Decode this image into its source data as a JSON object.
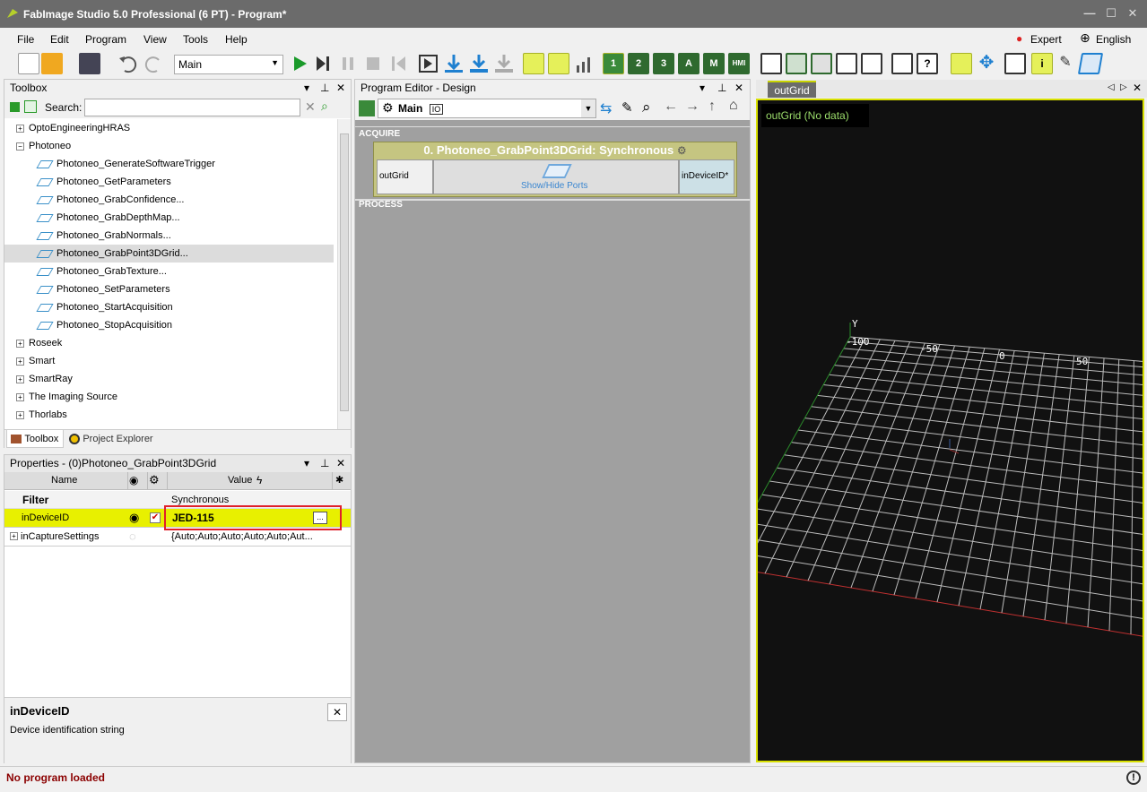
{
  "window": {
    "title": "FabImage Studio 5.0 Professional (6 PT) - Program*",
    "minimize": "—",
    "maximize": "☐",
    "close": "✕"
  },
  "menu": [
    "File",
    "Edit",
    "Program",
    "View",
    "Tools",
    "Help"
  ],
  "menu_right": {
    "expert": "Expert",
    "language": "English"
  },
  "toolbar": {
    "program_select": "Main",
    "toggle_buttons": [
      "1",
      "2",
      "3",
      "A",
      "M",
      "HMI"
    ]
  },
  "toolbox": {
    "title": "Toolbox",
    "search_label": "Search:",
    "search_value": "",
    "items": [
      {
        "label": "OptoEngineeringHRAS",
        "level": 0,
        "expand": "+"
      },
      {
        "label": "Photoneo",
        "level": 0,
        "expand": "−"
      },
      {
        "label": "Photoneo_GenerateSoftwareTrigger",
        "level": 1
      },
      {
        "label": "Photoneo_GetParameters",
        "level": 1
      },
      {
        "label": "Photoneo_GrabConfidence...",
        "level": 1
      },
      {
        "label": "Photoneo_GrabDepthMap...",
        "level": 1
      },
      {
        "label": "Photoneo_GrabNormals...",
        "level": 1
      },
      {
        "label": "Photoneo_GrabPoint3DGrid...",
        "level": 1,
        "selected": true
      },
      {
        "label": "Photoneo_GrabTexture...",
        "level": 1
      },
      {
        "label": "Photoneo_SetParameters",
        "level": 1
      },
      {
        "label": "Photoneo_StartAcquisition",
        "level": 1
      },
      {
        "label": "Photoneo_StopAcquisition",
        "level": 1
      },
      {
        "label": "Roseek",
        "level": 0,
        "expand": "+"
      },
      {
        "label": "Smart",
        "level": 0,
        "expand": "+"
      },
      {
        "label": "SmartRay",
        "level": 0,
        "expand": "+"
      },
      {
        "label": "The Imaging Source",
        "level": 0,
        "expand": "+"
      },
      {
        "label": "Thorlabs",
        "level": 0,
        "expand": "+"
      }
    ],
    "tabs": [
      "Toolbox",
      "Project Explorer"
    ]
  },
  "properties": {
    "title": "Properties - (0)Photoneo_GrabPoint3DGrid",
    "headers": {
      "name": "Name",
      "value": "Value"
    },
    "filter_label": "Filter",
    "filter_value": "Synchronous",
    "rows": [
      {
        "name": "inDeviceID",
        "value": "JED-115",
        "ellipsis": "...",
        "highlight": true
      },
      {
        "name": "inCaptureSettings",
        "value": "{Auto;Auto;Auto;Auto;Auto;Aut...",
        "expand": "+"
      }
    ],
    "desc_title": "inDeviceID",
    "desc_text": "Device identification string",
    "desc_close": "✕"
  },
  "editor": {
    "title": "Program Editor - Design",
    "program": "Main",
    "program_tag": "IO",
    "section_acquire": "ACQUIRE",
    "section_process": "PROCESS",
    "block_title": "0. Photoneo_GrabPoint3DGrid: Synchronous",
    "port_out": "outGrid",
    "port_in": "inDeviceID*",
    "show_hide": "Show/Hide Ports"
  },
  "viewer": {
    "tab": "outGrid",
    "caption": "outGrid (No data)",
    "axis_y": "Y",
    "tick_labels": [
      "-100",
      "-50",
      "0",
      "50"
    ]
  },
  "status": {
    "text": "No program loaded",
    "icon": "!"
  },
  "colors": {
    "highlight": "#e8f000",
    "status_text": "#8b0000",
    "viewer_border": "#d8e000",
    "viewer_text": "#9bdc6b",
    "title_bg": "#6b6b6b"
  }
}
